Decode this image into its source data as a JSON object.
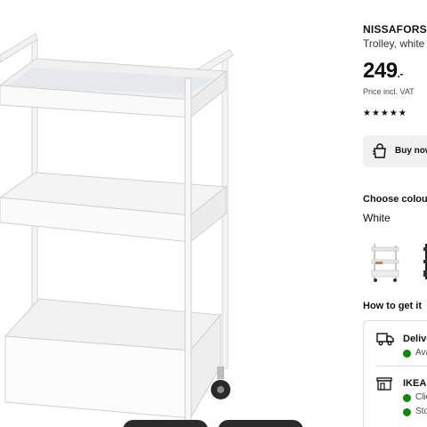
{
  "product": {
    "name": "NISSAFORS",
    "subtitle": "Trolley, white",
    "price_main": "249",
    "price_suffix": ".-",
    "price_note": "Price incl. VAT",
    "rating_stars": "★★★★★"
  },
  "buy": {
    "label": "Buy now"
  },
  "colour": {
    "heading": "Choose colour",
    "selected": "White",
    "options": [
      "White",
      "Black"
    ]
  },
  "delivery": {
    "heading": "How to get it",
    "rows": [
      {
        "title": "Delivery",
        "status": "Available"
      },
      {
        "title": "IKEA store",
        "status_1": "Click & Collect",
        "status_2": "Store"
      }
    ]
  },
  "colors": {
    "stock_green": "#0a8a00",
    "button_bg": "#f1f1f1"
  },
  "icons": [
    "shopping-bag-icon",
    "truck-icon",
    "store-icon"
  ]
}
